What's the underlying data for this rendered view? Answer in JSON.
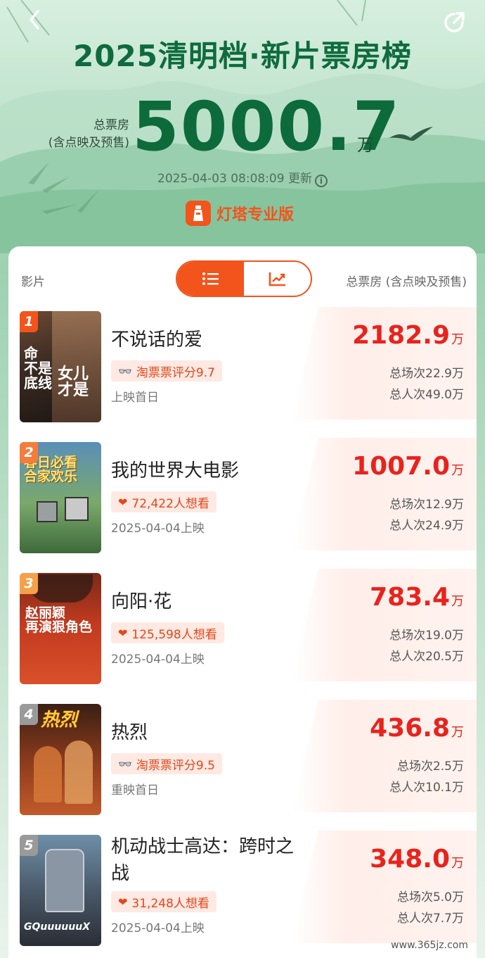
{
  "header": {
    "title": "2025清明档·新片票房榜",
    "total_label_line1": "总票房",
    "total_label_line2": "(含点映及预售)",
    "total_value": "5000.7",
    "total_unit": "万",
    "updated": "2025-04-03 08:08:09 更新",
    "brand": "灯塔专业版"
  },
  "list_header": {
    "film_col": "影片",
    "total_col": "总票房 (含点映及预售)"
  },
  "movies": [
    {
      "rank": "1",
      "title": "不说话的爱",
      "tag_icon": "glasses-icon",
      "tag": "淘票票评分9.7",
      "date": "上映首日",
      "box": "2182.9",
      "unit": "万",
      "sessions": "总场次22.9万",
      "people": "总人次49.0万",
      "poster_text": "命不是底线 女儿才是"
    },
    {
      "rank": "2",
      "title": "我的世界大电影",
      "tag_icon": "heart-icon",
      "tag": "72,422人想看",
      "date": "2025-04-04上映",
      "box": "1007.0",
      "unit": "万",
      "sessions": "总场次12.9万",
      "people": "总人次24.9万",
      "poster_text": "春日必看 合家欢乐"
    },
    {
      "rank": "3",
      "title": "向阳·花",
      "tag_icon": "heart-icon",
      "tag": "125,598人想看",
      "date": "2025-04-04上映",
      "box": "783.4",
      "unit": "万",
      "sessions": "总场次19.0万",
      "people": "总人次20.5万",
      "poster_text": "赵丽颖 再演狠角色"
    },
    {
      "rank": "4",
      "title": "热烈",
      "tag_icon": "glasses-icon",
      "tag": "淘票票评分9.5",
      "date": "重映首日",
      "box": "436.8",
      "unit": "万",
      "sessions": "总场次2.5万",
      "people": "总人次10.1万",
      "poster_text": "热烈"
    },
    {
      "rank": "5",
      "title": "机动战士高达：跨时之战",
      "tag_icon": "heart-icon",
      "tag": "31,248人想看",
      "date": "2025-04-04上映",
      "box": "348.0",
      "unit": "万",
      "sessions": "总场次5.0万",
      "people": "总人次7.7万",
      "poster_text": "GQuuuuuuX"
    }
  ],
  "watermark": "www.365jz.com",
  "colors": {
    "accent": "#f2541b",
    "box_red": "#e8231d",
    "title_green": "#0e6b3d"
  }
}
